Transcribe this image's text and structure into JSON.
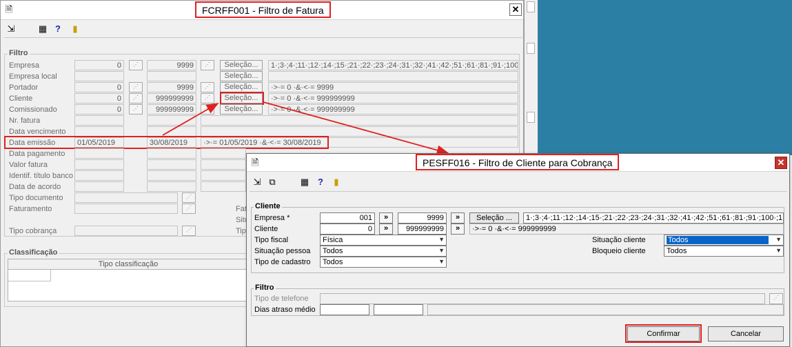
{
  "back_window": {
    "title": "FCRFF001 - Filtro de Fatura",
    "close_label": "✕",
    "filtro_label": "Filtro",
    "classificacao_label": "Classificação",
    "tipo_classificacao_header": "Tipo classificação",
    "selecao_label": "Seleção...",
    "rows": {
      "empresa": {
        "label": "Empresa",
        "from": "0",
        "to": "9999",
        "summary": "1·;3·;4·;11·;12·;14·;15·;21·;22·;23·;24·;31·;32·;41·;42·;51·;61·;81·;91·;100"
      },
      "empresa_local": {
        "label": "Empresa local"
      },
      "portador": {
        "label": "Portador",
        "from": "0",
        "to": "9999",
        "summary": "·>·= 0 ·&·<·= 9999"
      },
      "cliente": {
        "label": "Cliente",
        "from": "0",
        "to": "999999999",
        "summary": "·>·= 0 ·&·<·= 999999999"
      },
      "comissionado": {
        "label": "Comissionado",
        "from": "0",
        "to": "999999999",
        "summary": "·>·= 0 ·&·<·= 999999999"
      },
      "nr_fatura": {
        "label": "Nr. fatura"
      },
      "data_vencimento": {
        "label": "Data vencimento"
      },
      "data_emissao": {
        "label": "Data emissão",
        "from": "01/05/2019",
        "to": "30/08/2019",
        "summary": "·>·= 01/05/2019 ·&·<·= 30/08/2019"
      },
      "data_pagamento": {
        "label": "Data pagamento"
      },
      "valor_fatura": {
        "label": "Valor fatura"
      },
      "identif_titulo_banco": {
        "label": "Identif. título banco"
      },
      "data_de_acordo": {
        "label": "Data de acordo"
      },
      "tipo_documento": {
        "label": "Tipo documento"
      },
      "faturamento": {
        "label": "Faturamento"
      },
      "tipo_cobranca": {
        "label": "Tipo cobrança"
      }
    },
    "side_labels": [
      "Fat",
      "Situ",
      "Tipo"
    ]
  },
  "dialog": {
    "title": "PESFF016 - Filtro de Cliente para Cobrança",
    "close_label": "✕",
    "cliente_group": "Cliente",
    "filtro_group": "Filtro",
    "empresa_label": "Empresa *",
    "empresa_from": "001",
    "empresa_to": "9999",
    "selecao_label": "Seleção ...",
    "empresa_summary": "1·;3·;4·;11·;12·;14·;15·;21·;22·;23·;24·;31·;32·;41·;42·;51·;61·;81·;91·;100·;1",
    "cliente_label": "Cliente",
    "cliente_from": "0",
    "cliente_to": "999999999",
    "cliente_summary": "·>·= 0 ·&·<·= 999999999",
    "arrow_label": "»",
    "tipo_fiscal_label": "Tipo fiscal",
    "tipo_fiscal_value": "Física",
    "situacao_pessoa_label": "Situação pessoa",
    "situacao_pessoa_value": "Todos",
    "tipo_cadastro_label": "Tipo de cadastro",
    "tipo_cadastro_value": "Todos",
    "situacao_cliente_label": "Situação cliente",
    "situacao_cliente_value": "Todos",
    "bloqueio_cliente_label": "Bloqueio cliente",
    "bloqueio_cliente_value": "Todos",
    "tipo_telefone_label": "Tipo de telefone",
    "dias_atraso_label": "Dias atraso médio",
    "confirm_label": "Confirmar",
    "cancel_label": "Cancelar"
  },
  "colors": {
    "highlight": "#e02020",
    "desktop": "#2b7fa5",
    "selection": "#0a64c8"
  }
}
